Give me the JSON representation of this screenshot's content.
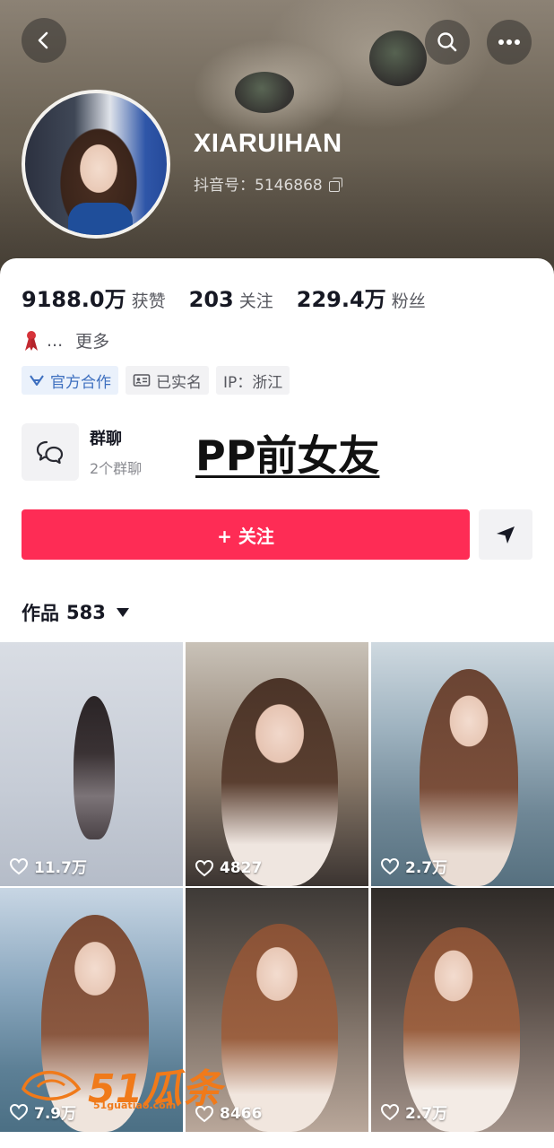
{
  "profile": {
    "nickname": "XIARUIHAN",
    "douyin_id": "抖音号：5146868"
  },
  "stats": [
    {
      "value": "9188.0万",
      "label": "获赞"
    },
    {
      "value": "203",
      "label": "关注"
    },
    {
      "value": "229.4万",
      "label": "粉丝"
    }
  ],
  "bio": {
    "ellipsis": "...",
    "more_label": "更多"
  },
  "tags": [
    {
      "label": "官方合作",
      "icon": "official-cooperation-icon"
    },
    {
      "label": "已实名",
      "icon": "id-card-icon"
    },
    {
      "label": "IP：浙江",
      "icon": ""
    }
  ],
  "group": {
    "title": "群聊",
    "subtitle": "2个群聊"
  },
  "overlay_caption": "PP前女友",
  "actions": {
    "follow_label": "+ 关注"
  },
  "works": {
    "label": "作品",
    "count": "583"
  },
  "videos": [
    {
      "likes": "11.7万"
    },
    {
      "likes": "4827"
    },
    {
      "likes": "2.7万"
    },
    {
      "likes": "7.9万"
    },
    {
      "likes": "8466"
    },
    {
      "likes": "2.7万"
    }
  ],
  "watermark": {
    "text": "51瓜条",
    "sub": "51guatiao.com"
  },
  "colors": {
    "accent": "#fe2c55",
    "official": "#3d6fbf",
    "watermark": "#f07a1a"
  }
}
